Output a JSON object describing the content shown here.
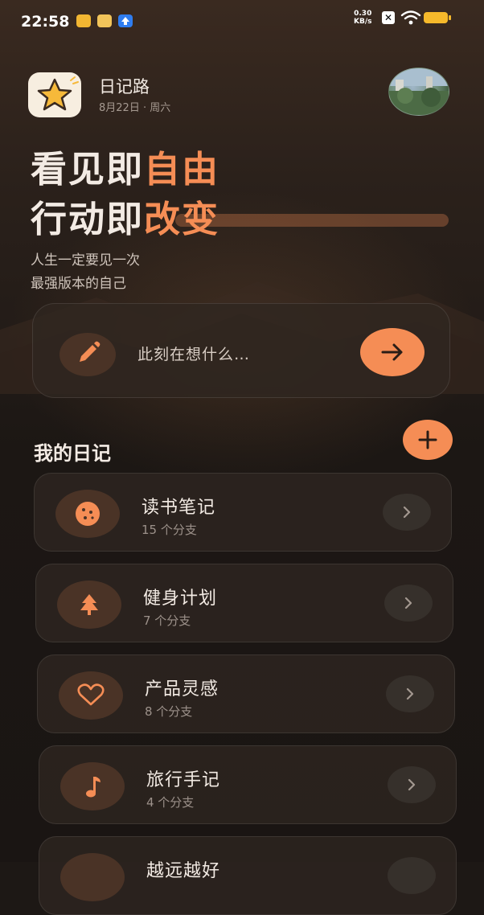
{
  "status_bar": {
    "time": "22:58",
    "net_speed_value": "0.30",
    "net_speed_unit": "KB/s"
  },
  "header": {
    "app_name": "日记路",
    "date": "8月22日 · 周六"
  },
  "hero": {
    "line1_prefix": "看见即",
    "line1_accent": "自由",
    "line2_prefix": "行动即",
    "line2_accent": "改变",
    "subtitle_line1": "人生一定要见一次",
    "subtitle_line2": "最强版本的自己"
  },
  "composer": {
    "placeholder": "此刻在想什么…"
  },
  "diaries": {
    "section_title": "我的日记",
    "items": [
      {
        "title": "读书笔记",
        "subtitle": "15 个分支",
        "icon": "cookie-icon"
      },
      {
        "title": "健身计划",
        "subtitle": "7 个分支",
        "icon": "tree-icon"
      },
      {
        "title": "产品灵感",
        "subtitle": "8 个分支",
        "icon": "heart-icon"
      },
      {
        "title": "旅行手记",
        "subtitle": "4 个分支",
        "icon": "music-note-icon"
      },
      {
        "title": "越远越好",
        "subtitle": "",
        "icon": "unknown-icon"
      }
    ]
  },
  "colors": {
    "accent": "#f58d55",
    "background": "#1d1815",
    "card": "#2d2520",
    "icon_circle": "#4a3326"
  }
}
